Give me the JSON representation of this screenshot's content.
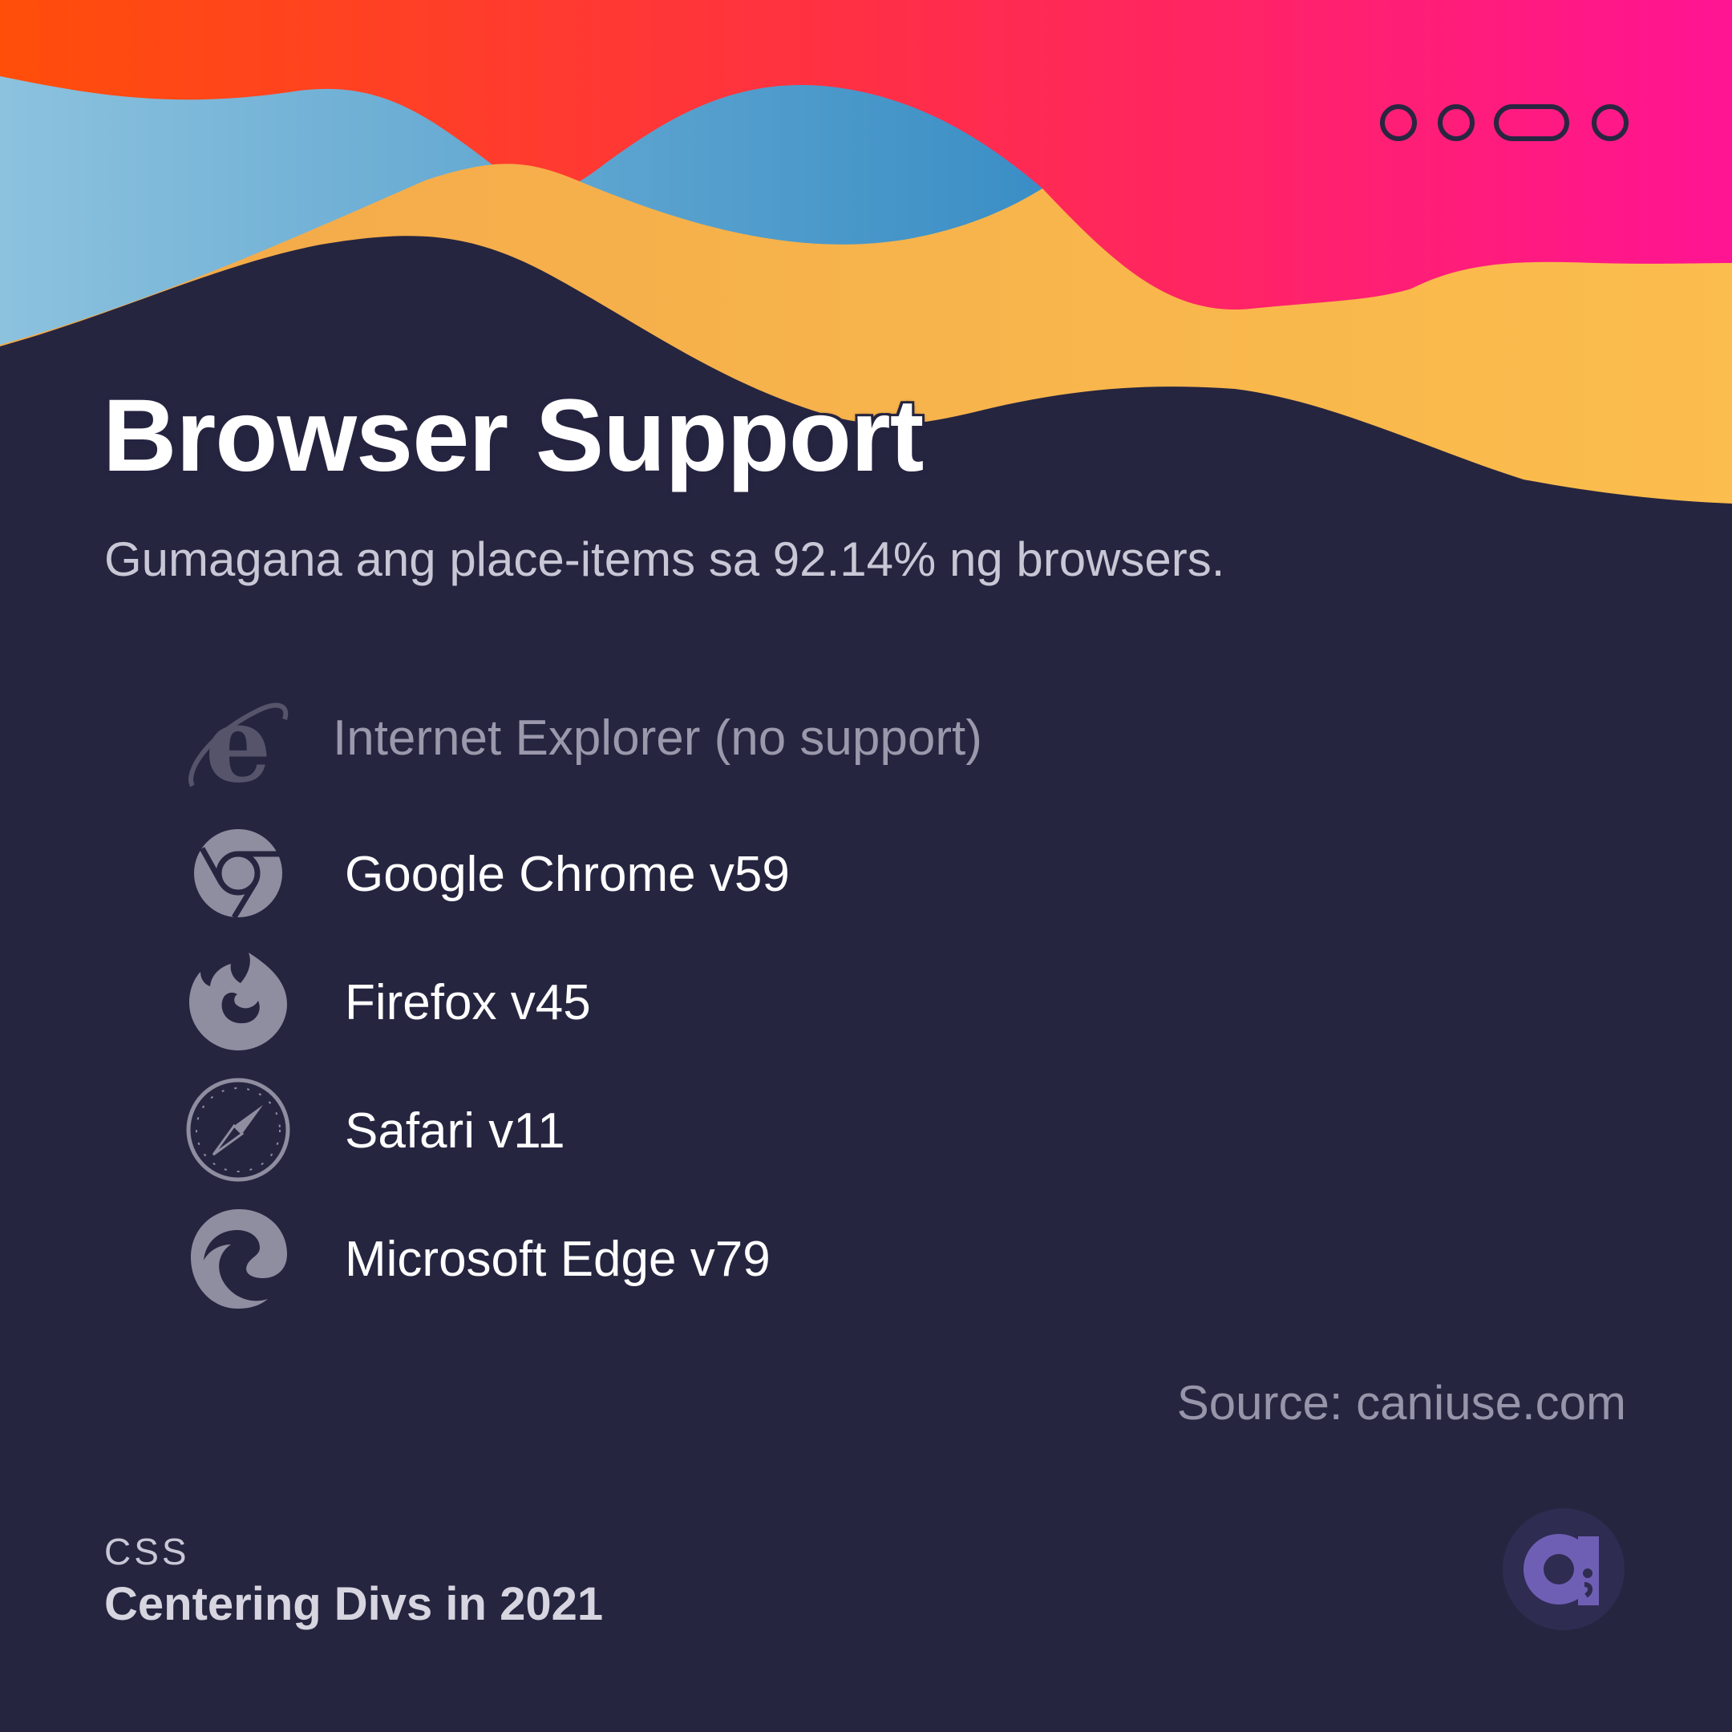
{
  "header": {
    "title": "Browser Support",
    "subtitle": "Gumagana ang place-items sa 92.14% ng browsers."
  },
  "browsers": [
    {
      "label": "Internet Explorer (no support)",
      "icon": "internet-explorer-icon",
      "supported": false
    },
    {
      "label": "Google Chrome v59",
      "icon": "chrome-icon",
      "supported": true
    },
    {
      "label": "Firefox v45",
      "icon": "firefox-icon",
      "supported": true
    },
    {
      "label": "Safari v11",
      "icon": "safari-icon",
      "supported": true
    },
    {
      "label": "Microsoft Edge v79",
      "icon": "edge-icon",
      "supported": true
    }
  ],
  "source": "Source: caniuse.com",
  "footer": {
    "category": "CSS",
    "series": "Centering Divs in 2021"
  },
  "colors": {
    "background": "#262540",
    "accent_red": "#ff4500",
    "accent_pink": "#ff1493",
    "accent_blue": "#3b8fc4",
    "accent_yellow": "#f8b54a",
    "logo": "#6f5fb4"
  }
}
